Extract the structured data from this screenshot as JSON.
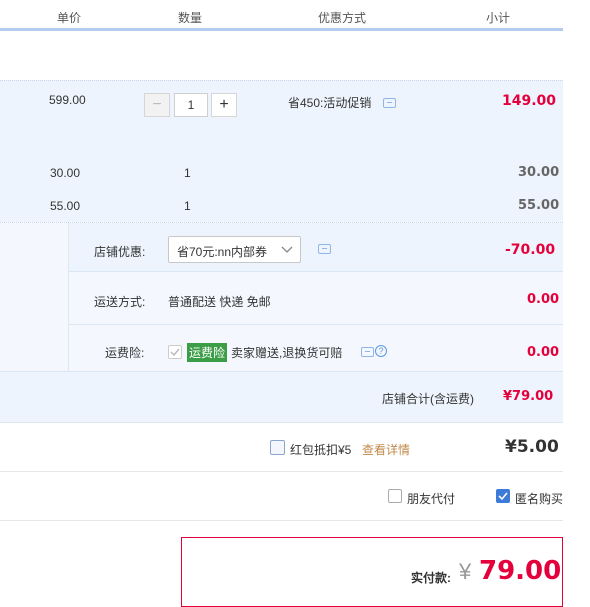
{
  "header": {
    "col_price": "单价",
    "col_qty": "数量",
    "col_promo": "优惠方式",
    "col_subtotal": "小计"
  },
  "items": [
    {
      "price": "599.00",
      "qty": "1",
      "promo": "省450:活动促销",
      "subtotal": "149.00"
    },
    {
      "price": "30.00",
      "qty": "1",
      "subtotal": "30.00"
    },
    {
      "price": "55.00",
      "qty": "1",
      "subtotal": "55.00"
    }
  ],
  "stepper": {
    "minus": "−",
    "value": "1",
    "plus": "+"
  },
  "store": {
    "discount_label": "店铺优惠:",
    "discount_select": "省70元:nn内部券",
    "discount_amount": "-70.00",
    "shipping_label": "运送方式:",
    "shipping_value": "普通配送 快递 免邮",
    "shipping_amount": "0.00",
    "insurance_label": "运费险:",
    "insurance_badge": "运费险",
    "insurance_desc": "卖家赠送,退换货可赔",
    "insurance_amount": "0.00",
    "total_label": "店铺合计(含运费)",
    "total_value": "¥79.00"
  },
  "redpacket": {
    "label": "红包抵扣¥5",
    "detail_link": "查看详情",
    "amount": "¥5.00"
  },
  "options": {
    "friend_pay": "朋友代付",
    "anonymous": "匿名购买"
  },
  "payment": {
    "label": "实付款:",
    "currency": "¥",
    "amount": "79.00"
  },
  "colors": {
    "accent_red": "#e4003a",
    "link_orange": "#c08a4a",
    "badge_green": "#3c9d47",
    "row_bg": "#eef4fd"
  }
}
